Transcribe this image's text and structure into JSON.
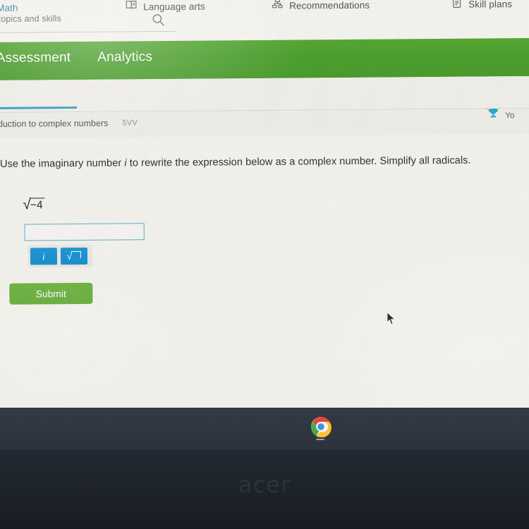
{
  "search": {
    "placeholder": "earch topics and skills",
    "icon": "search-icon"
  },
  "green_nav": {
    "items": [
      {
        "label": "Assessment"
      },
      {
        "label": "Analytics"
      }
    ]
  },
  "subject_tabs": [
    {
      "label": "Math",
      "icon": "calculator-icon",
      "active": true
    },
    {
      "label": "Language arts",
      "icon": "book-icon",
      "active": false
    },
    {
      "label": "Recommendations",
      "icon": "recommendations-icon",
      "active": false
    },
    {
      "label": "Skill plans",
      "icon": "clipboard-icon",
      "active": false
    }
  ],
  "skill": {
    "title": "ntroduction to complex numbers",
    "code": "5VV"
  },
  "score_chip": {
    "icon": "trophy-icon",
    "label": "Yo"
  },
  "question": {
    "prompt_part1": "Use the imaginary number ",
    "prompt_italic": "i",
    "prompt_part2": " to rewrite the expression below as a complex number. Simplify all radicals.",
    "expression_radicand": "−4",
    "expression_full": "√(−4)",
    "answer_value": "",
    "answer_placeholder": ""
  },
  "keypad": {
    "keys": [
      {
        "label": "i",
        "name": "imaginary-unit-key"
      },
      {
        "label": "√",
        "name": "radical-key"
      }
    ]
  },
  "actions": {
    "submit_label": "Submit"
  },
  "taskbar": {
    "items": [
      {
        "name": "chrome-icon",
        "label": "Google Chrome"
      }
    ]
  },
  "device": {
    "brand": "acer"
  },
  "colors": {
    "nav_green": "#4ea02f",
    "submit_green": "#6cb33f",
    "tab_active_teal": "#3fa0bd",
    "key_blue": "#2196d4",
    "screen_bg": "#f2f0eb"
  }
}
